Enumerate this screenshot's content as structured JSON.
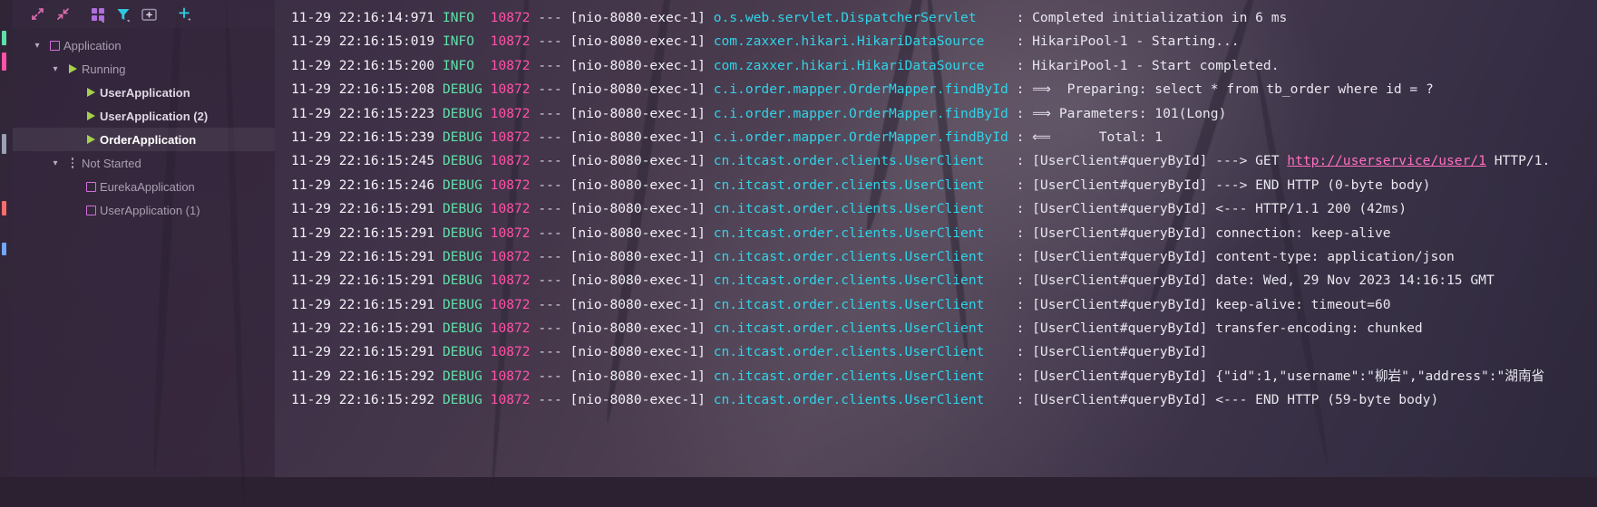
{
  "window": {
    "theme_accent": "#ec3a8a",
    "tree_icon_color": "#d36fd8",
    "run_icon_color": "#a5d14a",
    "logger_color": "#31d3e8",
    "pid_color": "#ff52a8",
    "level_color": "#5fe0a8",
    "link_color": "#ff6fc2"
  },
  "services": {
    "toolbar": {
      "buttons": [
        {
          "name": "expand-all-icon",
          "label": "Expand All",
          "glyph": "expand"
        },
        {
          "name": "collapse-all-icon",
          "label": "Collapse All",
          "glyph": "collapse"
        },
        {
          "name": "group-by-icon",
          "label": "Group By",
          "glyph": "grid"
        },
        {
          "name": "filter-icon",
          "label": "Filter",
          "glyph": "funnel"
        },
        {
          "name": "add-to-group-icon",
          "label": "Add to Group",
          "glyph": "addbox"
        },
        {
          "name": "add-service-icon",
          "label": "Add Service",
          "glyph": "plus"
        }
      ]
    },
    "tree": [
      {
        "label": "Application",
        "icon": "square",
        "twisty": "chevron-down",
        "indent": 0,
        "state": "dim",
        "selected": false
      },
      {
        "label": "Running",
        "icon": "play",
        "twisty": "chevron-down",
        "indent": 1,
        "state": "dim",
        "selected": false
      },
      {
        "label": "UserApplication",
        "icon": "play",
        "twisty": "none",
        "indent": 2,
        "state": "bright",
        "selected": false
      },
      {
        "label": "UserApplication (2)",
        "icon": "play",
        "twisty": "none",
        "indent": 2,
        "state": "bright",
        "selected": false
      },
      {
        "label": "OrderApplication",
        "icon": "play",
        "twisty": "none",
        "indent": 2,
        "state": "selected",
        "selected": true
      },
      {
        "label": "Not Started",
        "icon": "dots",
        "twisty": "chevron-down",
        "indent": 1,
        "state": "dim",
        "selected": false
      },
      {
        "label": "EurekaApplication",
        "icon": "square",
        "twisty": "none",
        "indent": 2,
        "state": "dim",
        "selected": false
      },
      {
        "label": "UserApplication (1)",
        "icon": "square",
        "twisty": "none",
        "indent": 2,
        "state": "dim",
        "selected": false
      }
    ]
  },
  "console": {
    "lines": [
      {
        "ts": "11-29 22:16:14:971",
        "level": "INFO ",
        "pid": "10872",
        "thread": "[nio-8080-exec-1]",
        "logger": "o.s.web.servlet.DispatcherServlet",
        "msg": ": Completed initialization in 6 ms"
      },
      {
        "ts": "11-29 22:16:15:019",
        "level": "INFO ",
        "pid": "10872",
        "thread": "[nio-8080-exec-1]",
        "logger": "com.zaxxer.hikari.HikariDataSource",
        "msg": ": HikariPool-1 - Starting..."
      },
      {
        "ts": "11-29 22:16:15:200",
        "level": "INFO ",
        "pid": "10872",
        "thread": "[nio-8080-exec-1]",
        "logger": "com.zaxxer.hikari.HikariDataSource",
        "msg": ": HikariPool-1 - Start completed."
      },
      {
        "ts": "11-29 22:16:15:208",
        "level": "DEBUG",
        "pid": "10872",
        "thread": "[nio-8080-exec-1]",
        "logger": "c.i.order.mapper.OrderMapper.findById",
        "msg": ": ⟹  Preparing: select * from tb_order where id = ?"
      },
      {
        "ts": "11-29 22:16:15:223",
        "level": "DEBUG",
        "pid": "10872",
        "thread": "[nio-8080-exec-1]",
        "logger": "c.i.order.mapper.OrderMapper.findById",
        "msg": ": ⟹ Parameters: 101(Long)"
      },
      {
        "ts": "11-29 22:16:15:239",
        "level": "DEBUG",
        "pid": "10872",
        "thread": "[nio-8080-exec-1]",
        "logger": "c.i.order.mapper.OrderMapper.findById",
        "msg": ": ⟸      Total: 1"
      },
      {
        "ts": "11-29 22:16:15:245",
        "level": "DEBUG",
        "pid": "10872",
        "thread": "[nio-8080-exec-1]",
        "logger": "cn.itcast.order.clients.UserClient",
        "msg": ": [UserClient#queryById] ---> GET ",
        "link": "http://userservice/user/1",
        "msg_after": " HTTP/1."
      },
      {
        "ts": "11-29 22:16:15:246",
        "level": "DEBUG",
        "pid": "10872",
        "thread": "[nio-8080-exec-1]",
        "logger": "cn.itcast.order.clients.UserClient",
        "msg": ": [UserClient#queryById] ---> END HTTP (0-byte body)"
      },
      {
        "ts": "11-29 22:16:15:291",
        "level": "DEBUG",
        "pid": "10872",
        "thread": "[nio-8080-exec-1]",
        "logger": "cn.itcast.order.clients.UserClient",
        "msg": ": [UserClient#queryById] <--- HTTP/1.1 200 (42ms)"
      },
      {
        "ts": "11-29 22:16:15:291",
        "level": "DEBUG",
        "pid": "10872",
        "thread": "[nio-8080-exec-1]",
        "logger": "cn.itcast.order.clients.UserClient",
        "msg": ": [UserClient#queryById] connection: keep-alive"
      },
      {
        "ts": "11-29 22:16:15:291",
        "level": "DEBUG",
        "pid": "10872",
        "thread": "[nio-8080-exec-1]",
        "logger": "cn.itcast.order.clients.UserClient",
        "msg": ": [UserClient#queryById] content-type: application/json"
      },
      {
        "ts": "11-29 22:16:15:291",
        "level": "DEBUG",
        "pid": "10872",
        "thread": "[nio-8080-exec-1]",
        "logger": "cn.itcast.order.clients.UserClient",
        "msg": ": [UserClient#queryById] date: Wed, 29 Nov 2023 14:16:15 GMT"
      },
      {
        "ts": "11-29 22:16:15:291",
        "level": "DEBUG",
        "pid": "10872",
        "thread": "[nio-8080-exec-1]",
        "logger": "cn.itcast.order.clients.UserClient",
        "msg": ": [UserClient#queryById] keep-alive: timeout=60"
      },
      {
        "ts": "11-29 22:16:15:291",
        "level": "DEBUG",
        "pid": "10872",
        "thread": "[nio-8080-exec-1]",
        "logger": "cn.itcast.order.clients.UserClient",
        "msg": ": [UserClient#queryById] transfer-encoding: chunked"
      },
      {
        "ts": "11-29 22:16:15:291",
        "level": "DEBUG",
        "pid": "10872",
        "thread": "[nio-8080-exec-1]",
        "logger": "cn.itcast.order.clients.UserClient",
        "msg": ": [UserClient#queryById]"
      },
      {
        "ts": "11-29 22:16:15:292",
        "level": "DEBUG",
        "pid": "10872",
        "thread": "[nio-8080-exec-1]",
        "logger": "cn.itcast.order.clients.UserClient",
        "msg": ": [UserClient#queryById] {\"id\":1,\"username\":\"柳岩\",\"address\":\"湖南省"
      },
      {
        "ts": "11-29 22:16:15:292",
        "level": "DEBUG",
        "pid": "10872",
        "thread": "[nio-8080-exec-1]",
        "logger": "cn.itcast.order.clients.UserClient",
        "msg": ": [UserClient#queryById] <--- END HTTP (59-byte body)"
      }
    ]
  }
}
